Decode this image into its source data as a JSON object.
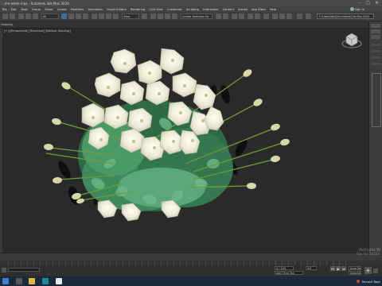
{
  "window": {
    "title": "...me-white.max - Autodesk 3ds Max 2020",
    "controls": [
      "–",
      "□",
      "✕"
    ]
  },
  "menu": {
    "items": [
      "File",
      "Edit",
      "Tools",
      "Group",
      "Views",
      "Create",
      "Modifiers",
      "Animation",
      "Graph Editors",
      "Rendering",
      "Civil View",
      "Customize",
      "Scripting",
      "Interactive",
      "Content",
      "Arnold",
      "App Store",
      "Help"
    ],
    "user_label": "Sign In"
  },
  "toolbar": {
    "filter_label": "All",
    "view_label": "View",
    "selection_set_placeholder": "Create Selection Se",
    "project_path": "C:\\Users\\Win\\Documents\\3ds Max 2020"
  },
  "ribbon": {
    "label": "Modeling"
  },
  "viewport": {
    "label": "[+] [Perspective] [Standard] [Default Shading]"
  },
  "statusbar": {
    "coordinate_label": "0/0",
    "selection_lock_label": "Add Time Tag",
    "frame_label": "0 / 100",
    "auto_key_label": "Auto Key",
    "set_key_label": "Set Key",
    "key_filters_label": "Selected"
  },
  "watermark": {
    "line1": "Activate W",
    "line2": "Go to Settin"
  },
  "taskbar": {
    "tray_record_label": "Record Tagh",
    "tray_lang": "ENG"
  }
}
